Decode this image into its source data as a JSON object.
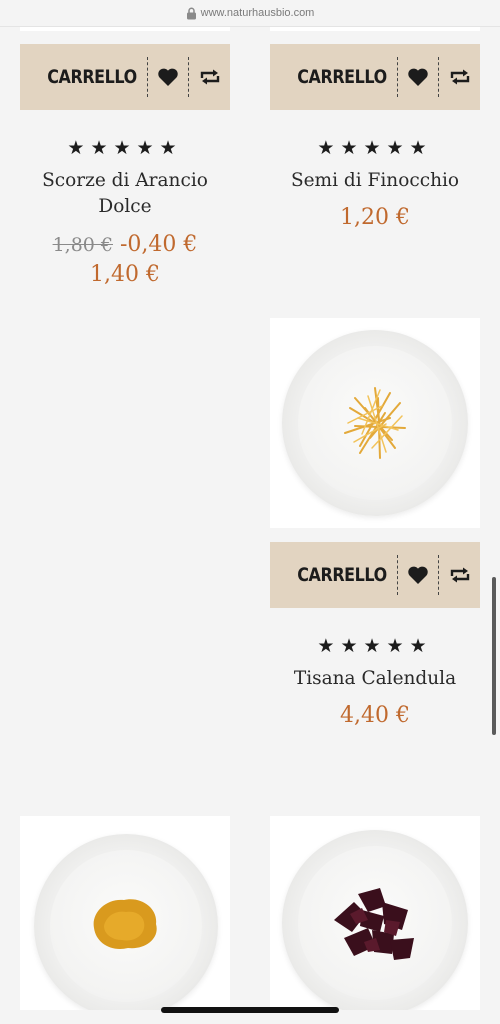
{
  "browser": {
    "url": "www.naturhausbio.com"
  },
  "cart_label": "CARRELLO",
  "stars": "★★★★★",
  "products": [
    {
      "name": "Scorze di Arancio Dolce",
      "old_price": "1,80 €",
      "discount": "-0,40 €",
      "price": "1,40 €"
    },
    {
      "name": "Semi di Finocchio",
      "price": "1,20 €"
    },
    {
      "name": "Tisana Calendula",
      "price": "4,40 €"
    }
  ],
  "colors": {
    "cart_bar": "#e2d4c1",
    "price": "#c0692e",
    "background": "#f4f4f4"
  },
  "icons": [
    "lock-icon",
    "heart-icon",
    "compare-icon",
    "star-icon"
  ]
}
